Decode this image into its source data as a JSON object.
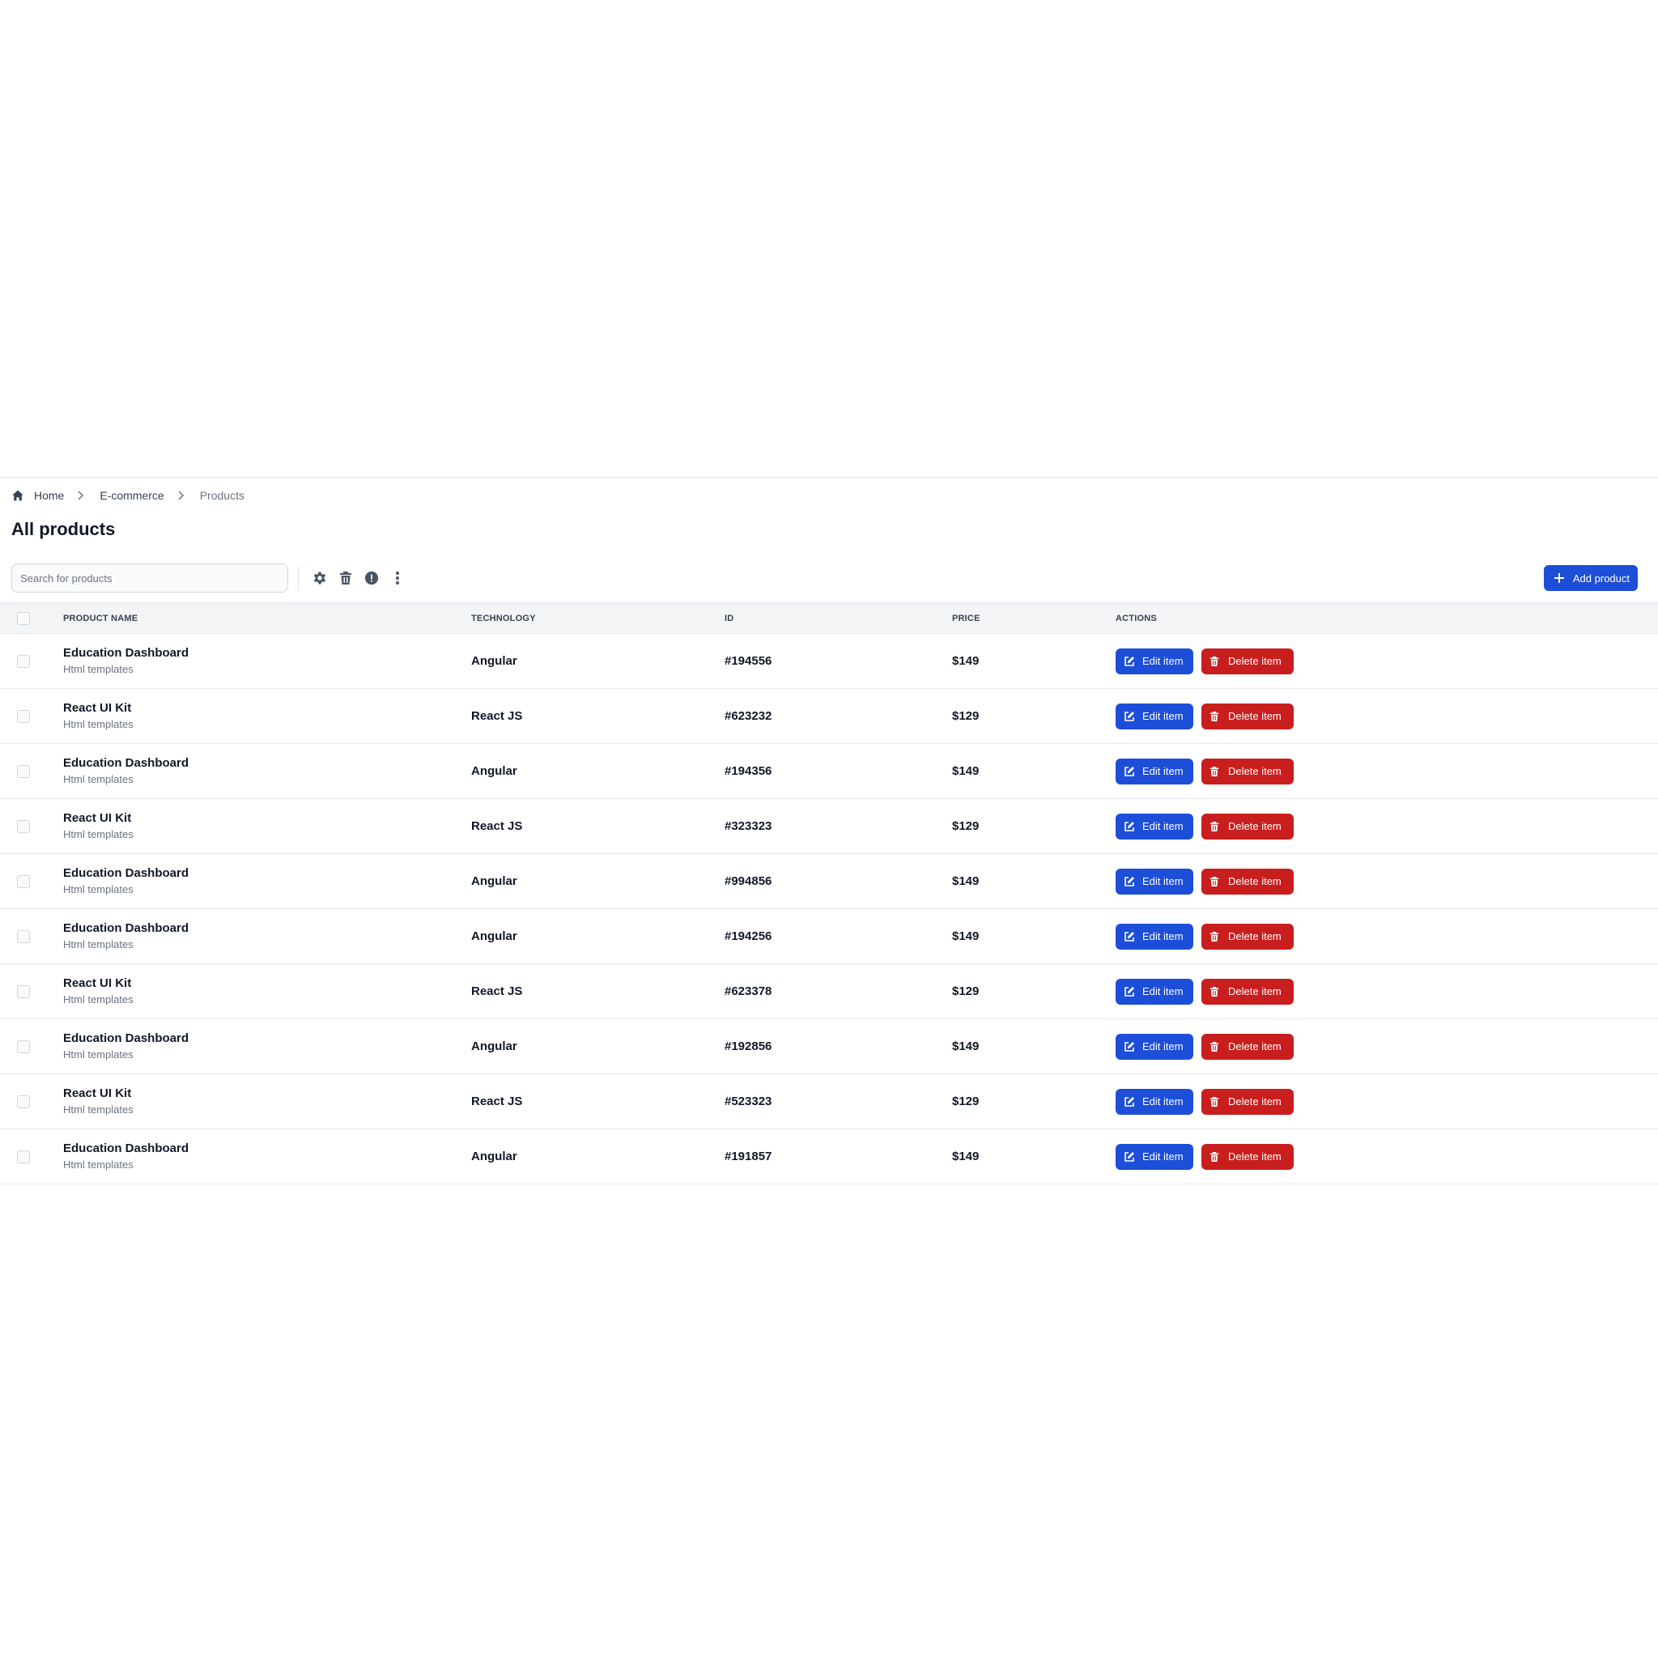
{
  "breadcrumb": {
    "items": [
      {
        "label": "Home",
        "icon": "home-icon"
      },
      {
        "label": "E-commerce"
      },
      {
        "label": "Products"
      }
    ]
  },
  "page_title": "All products",
  "search": {
    "placeholder": "Search for products",
    "value": ""
  },
  "toolbar_icons": [
    "gear-icon",
    "trash-icon",
    "alert-circle-icon",
    "more-vertical-icon"
  ],
  "add_button": {
    "label": "Add product",
    "icon": "plus-icon"
  },
  "table": {
    "columns": [
      "PRODUCT NAME",
      "TECHNOLOGY",
      "ID",
      "PRICE",
      "ACTIONS"
    ],
    "rows": [
      {
        "name": "Education Dashboard",
        "category": "Html templates",
        "technology": "Angular",
        "id": "#194556",
        "price": "$149"
      },
      {
        "name": "React UI Kit",
        "category": "Html templates",
        "technology": "React JS",
        "id": "#623232",
        "price": "$129"
      },
      {
        "name": "Education Dashboard",
        "category": "Html templates",
        "technology": "Angular",
        "id": "#194356",
        "price": "$149"
      },
      {
        "name": "React UI Kit",
        "category": "Html templates",
        "technology": "React JS",
        "id": "#323323",
        "price": "$129"
      },
      {
        "name": "Education Dashboard",
        "category": "Html templates",
        "technology": "Angular",
        "id": "#994856",
        "price": "$149"
      },
      {
        "name": "Education Dashboard",
        "category": "Html templates",
        "technology": "Angular",
        "id": "#194256",
        "price": "$149"
      },
      {
        "name": "React UI Kit",
        "category": "Html templates",
        "technology": "React JS",
        "id": "#623378",
        "price": "$129"
      },
      {
        "name": "Education Dashboard",
        "category": "Html templates",
        "technology": "Angular",
        "id": "#192856",
        "price": "$149"
      },
      {
        "name": "React UI Kit",
        "category": "Html templates",
        "technology": "React JS",
        "id": "#523323",
        "price": "$129"
      },
      {
        "name": "Education Dashboard",
        "category": "Html templates",
        "technology": "Angular",
        "id": "#191857",
        "price": "$149"
      }
    ],
    "edit_label": "Edit item",
    "delete_label": "Delete item"
  },
  "colors": {
    "primary": "#1d4ed8",
    "danger": "#c81e1e",
    "header_bg": "#f3f4f6"
  }
}
